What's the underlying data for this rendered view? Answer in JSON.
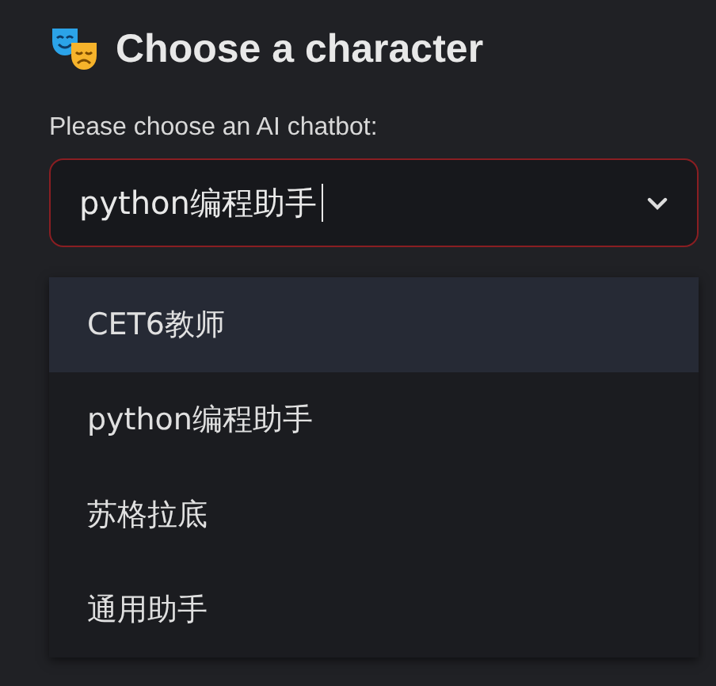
{
  "title": "Choose a character",
  "select": {
    "label": "Please choose an AI chatbot:",
    "value": "python编程助手",
    "focused": true
  },
  "options": [
    {
      "label": "CET6教师",
      "highlighted": true
    },
    {
      "label": "python编程助手",
      "highlighted": false
    },
    {
      "label": "苏格拉底",
      "highlighted": false
    },
    {
      "label": "通用助手",
      "highlighted": false
    }
  ]
}
